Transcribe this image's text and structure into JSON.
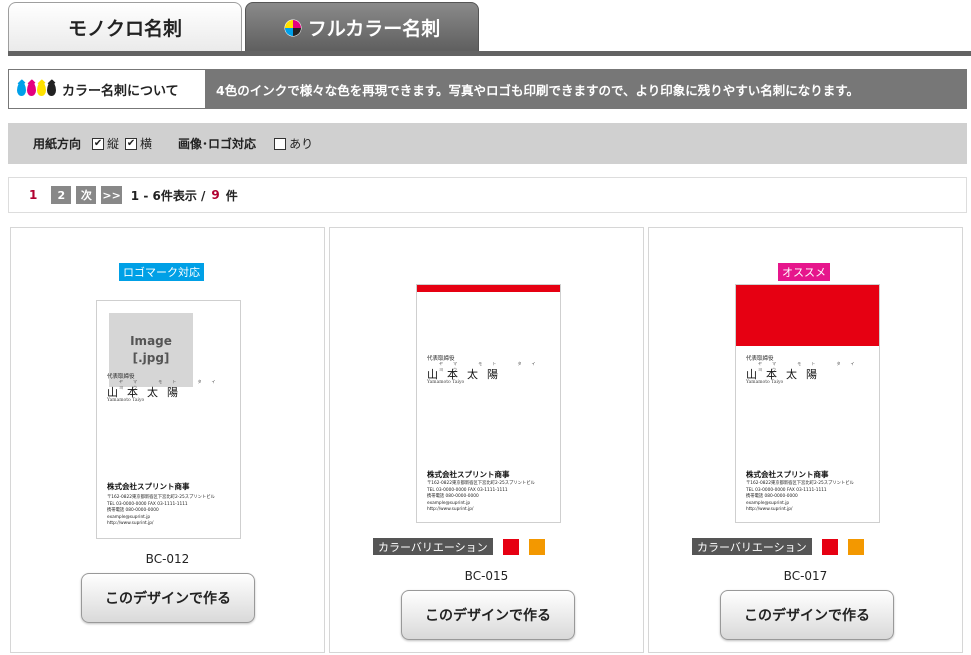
{
  "tabs": {
    "mono": "モノクロ名刺",
    "full": "フルカラー名刺"
  },
  "about": {
    "label": "カラー名刺について",
    "text": "4色のインクで様々な色を再現できます。写真やロゴも印刷できますので、より印象に残りやすい名刺になります。",
    "ink_colors": [
      "#00a0e9",
      "#e4007f",
      "#ffe100",
      "#222222"
    ]
  },
  "filter": {
    "orientation_label": "用紙方向",
    "vertical": "縦",
    "vertical_checked": "✔",
    "horizontal": "横",
    "horizontal_checked": "✔",
    "logo_label": "画像･ロゴ対応",
    "logo_option": "あり"
  },
  "pagination": {
    "current": "1",
    "page2": "2",
    "next": "次",
    "last": ">>",
    "range": "1 - 6件表示 /",
    "total": "9",
    "unit": "件"
  },
  "cards": [
    {
      "badge": "ロゴマーク対応",
      "image_line1": "Image",
      "image_line2": "[.jpg]",
      "role": "代表取締役",
      "kana": "ヤマ モト タイ ヨウ",
      "name": "山本太陽",
      "roman": "Yamamoto Taiyo",
      "company": "株式会社スプリント商事",
      "address": [
        "〒162-0822東京都新宿区下宮比町2-25スプリントビル",
        "TEL 03-0000-0000 FAX 03-1111-1111",
        "携帯電話 080-0000-0000",
        "example@suprint.jp",
        "http://www.suprint.jp/"
      ],
      "code": "BC-012",
      "button": "このデザインで作る"
    },
    {
      "role": "代表取締役",
      "kana": "ヤマ モト タイ ヨウ",
      "name": "山本太陽",
      "roman": "Yamamoto Taiyo",
      "company": "株式会社スプリント商事",
      "address": [
        "〒162-0822東京都新宿区下宮比町2-25スプリントビル",
        "TEL 03-0000-0000 FAX 03-1111-1111",
        "携帯電話 080-0000-0000",
        "example@suprint.jp",
        "http://www.suprint.jp/"
      ],
      "variation": "カラーバリエーション",
      "swatches": [
        "#e60012",
        "#f39800"
      ],
      "code": "BC-015",
      "button": "このデザインで作る"
    },
    {
      "badge": "オススメ",
      "role": "代表取締役",
      "kana": "ヤマ モト タイ ヨウ",
      "name": "山本太陽",
      "roman": "Yamamoto Taiyo",
      "company": "株式会社スプリント商事",
      "address": [
        "〒162-0822東京都新宿区下宮比町2-25スプリントビル",
        "TEL 03-0000-0000 FAX 03-1111-1111",
        "携帯電話 080-0000-0000",
        "example@suprint.jp",
        "http://www.suprint.jp/"
      ],
      "variation": "カラーバリエーション",
      "swatches": [
        "#e60012",
        "#f39800"
      ],
      "code": "BC-017",
      "button": "このデザインで作る"
    }
  ]
}
